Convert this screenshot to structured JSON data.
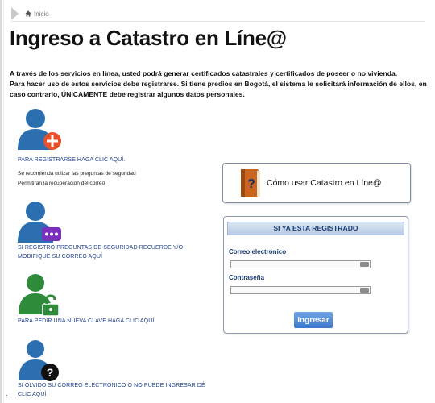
{
  "breadcrumb": {
    "home_label": "Inicio"
  },
  "page": {
    "title": "Ingreso a Catastro en Líne@"
  },
  "intro": {
    "line1": "A través de los servicios en línea, usted podrá generar certificados catastrales y certificados de poseer o no vivienda.",
    "line2": "Para hacer uso de estos servicios debe registrarse. Si tiene predios en Bogotá, el sistema le solicitará información de ellos, en caso contrario, ÚNICAMENTE debe registrar algunos datos personales."
  },
  "actions": {
    "register": {
      "link": "PARA REGISTRARSE HAGA CLIC AQUÍ.",
      "note1": "Se recomienda utilizar las preguntas de seguridad",
      "note2": "Permitirán la recuperacion del correo",
      "icon": "user-add-icon"
    },
    "security_questions": {
      "link": "SI REGISTRO PREGUNTAS DE SEGURIDAD RECUERDE Y/O MODIFIQUE SU CORREO AQUÍ",
      "icon": "user-chat-icon"
    },
    "new_password": {
      "link": "PARA PEDIR UNA NUEVA CLAVE HAGA CLIC AQUÍ",
      "icon": "user-lock-icon"
    },
    "forgot_email": {
      "link": "SI OLVIDO SU CORREO ELECTRONICO O NO PUEDE INGRESAR DÉ CLIC AQUÍ",
      "icon": "user-question-icon"
    }
  },
  "help": {
    "label": "Cómo usar Catastro en Líne@",
    "icon": "book-help-icon"
  },
  "login": {
    "header": "SI YA ESTA REGISTRADO",
    "email_label": "Correo electrónico",
    "email_value": "",
    "password_label": "Contraseña",
    "password_value": "",
    "submit_label": "Ingresar"
  },
  "colors": {
    "link": "#1f3f8e",
    "user_icon": "#2b6fb0",
    "add_badge": "#e8502a",
    "chat_badge": "#7b2fbf",
    "lock_badge": "#2e8b3a",
    "question_badge": "#111111",
    "login_button": "#3f77c9"
  }
}
